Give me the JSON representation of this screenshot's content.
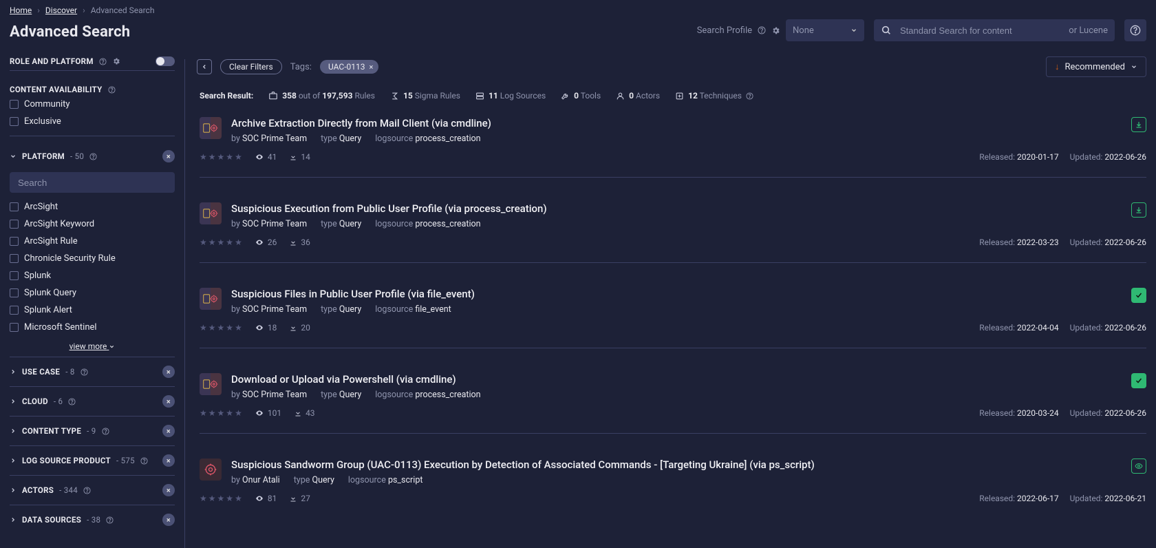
{
  "breadcrumb": [
    "Home",
    "Discover",
    "Advanced Search"
  ],
  "page_title": "Advanced Search",
  "search_profile_label": "Search Profile",
  "profile_select_value": "None",
  "search_placeholder": "Standard Search for content",
  "lucene_label": "or Lucene",
  "sidebar": {
    "role_platform": "ROLE AND PLATFORM",
    "content_avail": "CONTENT AVAILABILITY",
    "avail_items": [
      "Community",
      "Exclusive"
    ],
    "platform_label": "PLATFORM",
    "platform_count": "- 50",
    "platform_search_placeholder": "Search",
    "platform_items": [
      "ArcSight",
      "ArcSight Keyword",
      "ArcSight Rule",
      "Chronicle Security Rule",
      "Splunk",
      "Splunk Query",
      "Splunk Alert",
      "Microsoft Sentinel"
    ],
    "view_more": "view more",
    "filters": [
      {
        "label": "USE CASE",
        "count": "- 8"
      },
      {
        "label": "CLOUD",
        "count": "- 6"
      },
      {
        "label": "CONTENT TYPE",
        "count": "- 9"
      },
      {
        "label": "LOG SOURCE PRODUCT",
        "count": "- 575"
      },
      {
        "label": "ACTORS",
        "count": "- 344"
      },
      {
        "label": "DATA SOURCES",
        "count": "- 38"
      }
    ]
  },
  "filters_bar": {
    "clear": "Clear Filters",
    "tags_label": "Tags:",
    "tag_value": "UAC-0113",
    "sort_label": "Recommended"
  },
  "summary": {
    "label": "Search Result:",
    "rules_count": "358",
    "rules_of": " out of ",
    "rules_total": "197,593",
    "rules_suf": " Rules",
    "sigma": "15",
    "sigma_suf": " Sigma Rules",
    "log": "11",
    "log_suf": " Log Sources",
    "tools": "0",
    "tools_suf": " Tools",
    "actors": "0",
    "actors_suf": " Actors",
    "tech": "12",
    "tech_suf": " Techniques"
  },
  "labels": {
    "by": "by ",
    "type": "type ",
    "logsource": "logsource ",
    "released": "Released: ",
    "updated": "Updated: "
  },
  "results": [
    {
      "title": "Archive Extraction Directly from Mail Client (via cmdline)",
      "author": "SOC Prime Team",
      "type": "Query",
      "logsource": "process_creation",
      "views": "41",
      "downloads": "14",
      "released": "2020-01-17",
      "updated": "2022-06-26",
      "state": "download",
      "icon": "dual"
    },
    {
      "title": "Suspicious Execution from Public User Profile (via process_creation)",
      "author": "SOC Prime Team",
      "type": "Query",
      "logsource": "process_creation",
      "views": "26",
      "downloads": "36",
      "released": "2022-03-23",
      "updated": "2022-06-26",
      "state": "download",
      "icon": "dual"
    },
    {
      "title": "Suspicious Files in Public User Profile (via file_event)",
      "author": "SOC Prime Team",
      "type": "Query",
      "logsource": "file_event",
      "views": "18",
      "downloads": "20",
      "released": "2022-04-04",
      "updated": "2022-06-26",
      "state": "check",
      "icon": "dual"
    },
    {
      "title": "Download or Upload via Powershell (via cmdline)",
      "author": "SOC Prime Team",
      "type": "Query",
      "logsource": "process_creation",
      "views": "101",
      "downloads": "43",
      "released": "2020-03-24",
      "updated": "2022-06-26",
      "state": "check",
      "icon": "dual"
    },
    {
      "title": "Suspicious Sandworm Group (UAC-0113) Execution by Detection of Associated Commands - [Targeting Ukraine] (via ps_script)",
      "author": "Onur Atali",
      "type": "Query",
      "logsource": "ps_script",
      "views": "81",
      "downloads": "27",
      "released": "2022-06-17",
      "updated": "2022-06-21",
      "state": "eye",
      "icon": "red"
    }
  ]
}
